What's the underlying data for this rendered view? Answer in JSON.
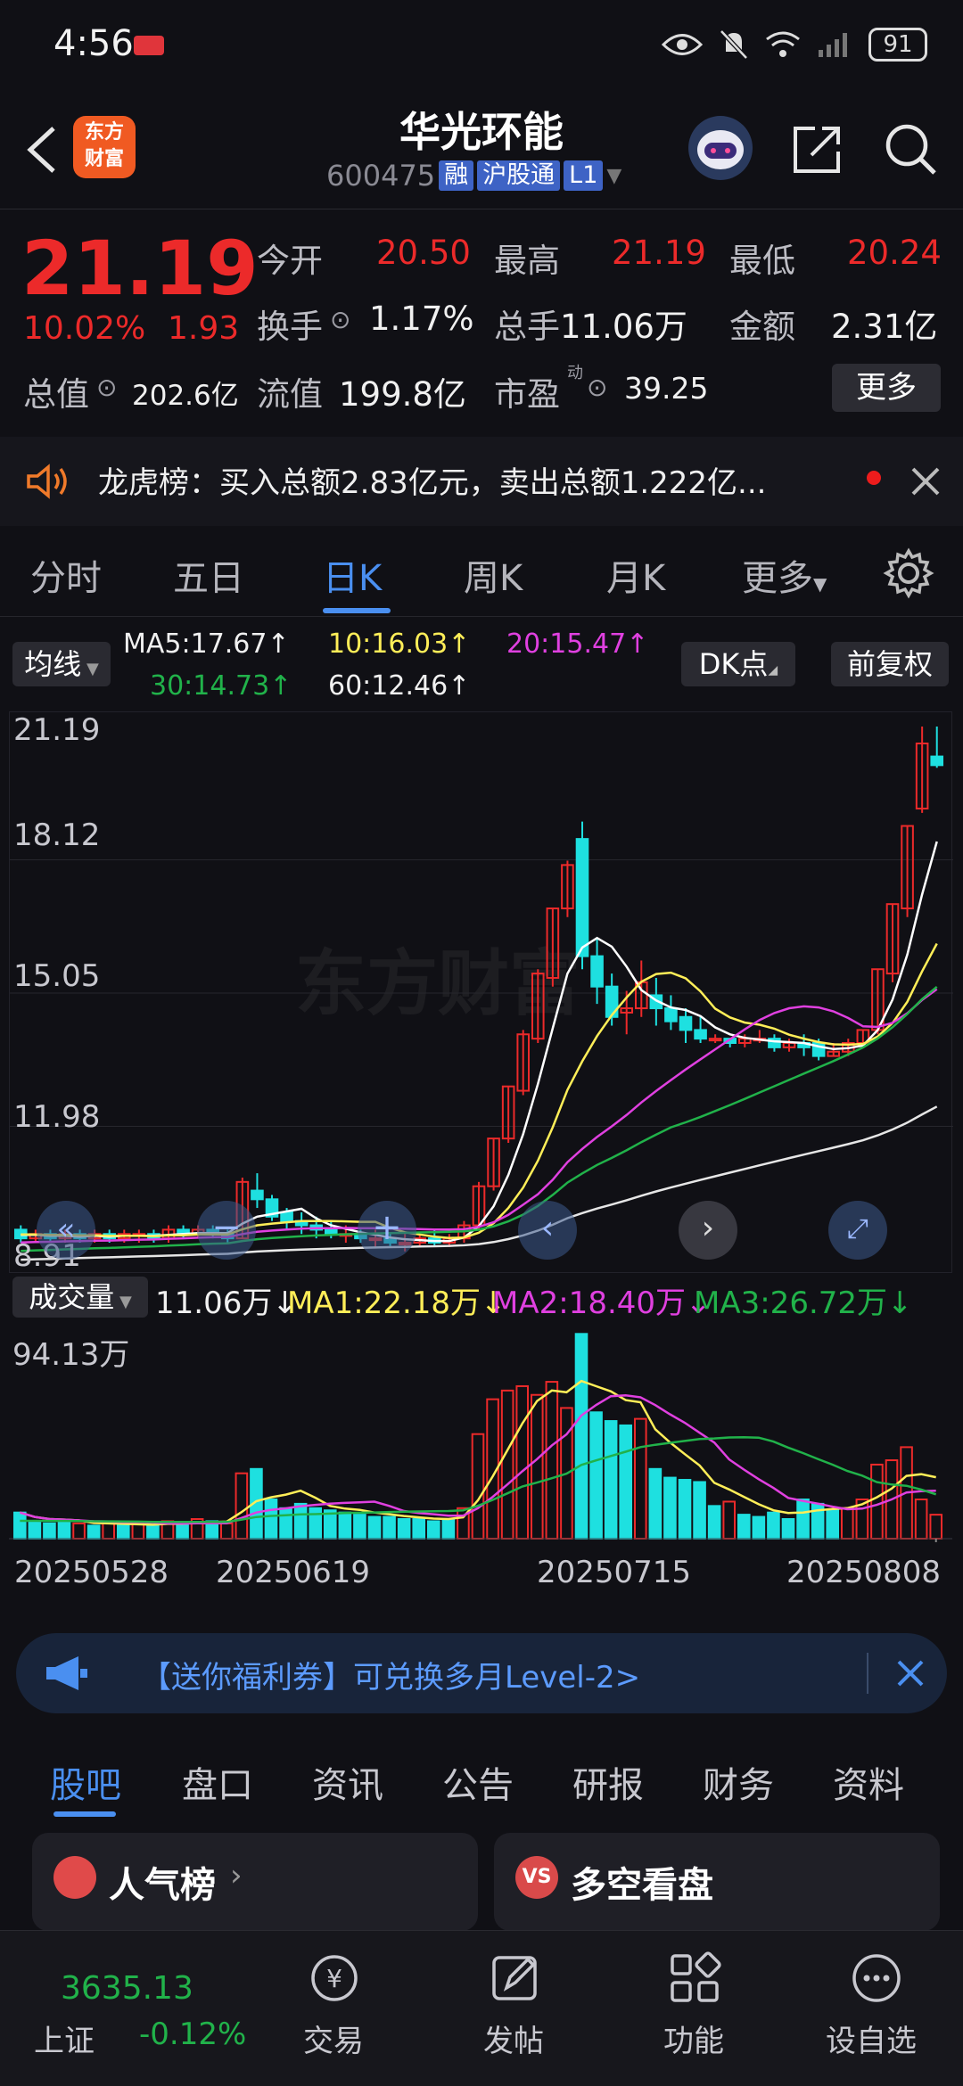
{
  "status_bar": {
    "time": "4:56",
    "battery": "91"
  },
  "header": {
    "stock_name": "华光环能",
    "code": "600475",
    "tags": [
      "融",
      "沪股通",
      "L1"
    ],
    "logo_line1": "东方",
    "logo_line2": "财富"
  },
  "quote": {
    "price": "21.19",
    "change_pct": "10.02%",
    "change_amt": "1.93",
    "fields": {
      "open_label": "今开",
      "open": "20.50",
      "high_label": "最高",
      "high": "21.19",
      "low_label": "最低",
      "low": "20.24",
      "turnover_label": "换手",
      "turnover": "1.17%",
      "volume_label": "总手",
      "volume": "11.06万",
      "amount_label": "金额",
      "amount": "2.31亿",
      "mcap_label": "总值",
      "mcap": "202.6亿",
      "float_label": "流值",
      "float": "199.8亿",
      "pe_label": "市盈",
      "pe_sup": "动",
      "pe": "39.25"
    },
    "more_label": "更多"
  },
  "notice": {
    "text": "龙虎榜：买入总额2.83亿元，卖出总额1.222亿..."
  },
  "period_tabs": [
    "分时",
    "五日",
    "日K",
    "周K",
    "月K",
    "更多"
  ],
  "active_period": "日K",
  "ma_legend": {
    "selector": "均线",
    "ma5": "MA5:17.67↑",
    "ma10": "10:16.03↑",
    "ma20": "20:15.47↑",
    "ma30": "30:14.73↑",
    "ma60": "60:12.46↑",
    "dk_button": "DK点",
    "adjust_button": "前复权"
  },
  "price_axis": [
    "21.19",
    "18.12",
    "15.05",
    "11.98",
    "8.91"
  ],
  "volume_legend": {
    "selector": "成交量",
    "vol": "11.06万↓",
    "ma1": "MA1:22.18万↓",
    "ma2": "MA2:18.40万↓",
    "ma3": "MA3:26.72万↓",
    "max": "94.13万"
  },
  "x_dates": [
    "20250528",
    "20250619",
    "20250715",
    "20250808"
  ],
  "watermark": "东方财富",
  "promo": {
    "text": "【送你福利券】可兑换多月Level-2>"
  },
  "section_tabs": [
    "股吧",
    "盘口",
    "资讯",
    "公告",
    "研报",
    "财务",
    "资料"
  ],
  "cards": [
    {
      "title": "人气榜"
    },
    {
      "title": "多空看盘"
    }
  ],
  "bottom_nav": {
    "index_value": "3635.13",
    "index_name": "上证",
    "index_change": "-0.12%",
    "items": [
      "交易",
      "发帖",
      "功能",
      "设自选"
    ]
  },
  "colors": {
    "up": "#ec2a2a",
    "down": "#1ee0e0",
    "accent": "#4a8ff0",
    "ma5": "#ffffff",
    "ma10": "#ffee58",
    "ma20": "#e040e0",
    "ma30": "#21b24a",
    "ma60": "#e6e6e6"
  },
  "chart_data": {
    "type": "candlestick",
    "y_range": [
      8.91,
      21.19
    ],
    "candles": [
      [
        9.6,
        9.4,
        9.7,
        9.3
      ],
      [
        9.4,
        9.5,
        9.6,
        9.3
      ],
      [
        9.5,
        9.4,
        9.6,
        9.3
      ],
      [
        9.4,
        9.5,
        9.6,
        9.3
      ],
      [
        9.5,
        9.4,
        9.6,
        9.3
      ],
      [
        9.4,
        9.5,
        9.6,
        9.3
      ],
      [
        9.5,
        9.4,
        9.6,
        9.3
      ],
      [
        9.4,
        9.5,
        9.6,
        9.3
      ],
      [
        9.5,
        9.5,
        9.6,
        9.3
      ],
      [
        9.5,
        9.4,
        9.6,
        9.3
      ],
      [
        9.4,
        9.6,
        9.7,
        9.3
      ],
      [
        9.6,
        9.5,
        9.7,
        9.4
      ],
      [
        9.5,
        9.6,
        9.7,
        9.4
      ],
      [
        9.6,
        9.5,
        9.7,
        9.4
      ],
      [
        9.5,
        9.4,
        9.6,
        9.3
      ],
      [
        9.4,
        10.7,
        10.8,
        9.4
      ],
      [
        10.5,
        10.3,
        10.9,
        10.1
      ],
      [
        10.3,
        9.9,
        10.4,
        9.8
      ],
      [
        10.0,
        9.8,
        10.1,
        9.6
      ],
      [
        9.8,
        9.7,
        10.0,
        9.5
      ],
      [
        9.7,
        9.6,
        9.9,
        9.4
      ],
      [
        9.6,
        9.5,
        9.8,
        9.4
      ],
      [
        9.5,
        9.5,
        9.7,
        9.3
      ],
      [
        9.5,
        9.4,
        9.6,
        9.3
      ],
      [
        9.4,
        9.4,
        9.6,
        9.2
      ],
      [
        9.4,
        9.3,
        9.5,
        9.2
      ],
      [
        9.3,
        9.3,
        9.5,
        9.1
      ],
      [
        9.3,
        9.4,
        9.5,
        9.2
      ],
      [
        9.4,
        9.3,
        9.6,
        9.2
      ],
      [
        9.3,
        9.4,
        9.5,
        9.2
      ],
      [
        9.4,
        9.7,
        9.8,
        9.3
      ],
      [
        9.7,
        10.6,
        10.7,
        9.6
      ],
      [
        10.6,
        11.7,
        11.7,
        10.5
      ],
      [
        11.7,
        12.9,
        12.9,
        11.6
      ],
      [
        12.8,
        14.1,
        14.2,
        12.7
      ],
      [
        14.0,
        15.5,
        15.6,
        13.9
      ],
      [
        15.4,
        17.0,
        17.0,
        15.2
      ],
      [
        17.0,
        18.0,
        18.1,
        16.8
      ],
      [
        18.6,
        15.9,
        19.0,
        15.6
      ],
      [
        15.9,
        15.2,
        16.3,
        14.8
      ],
      [
        15.2,
        14.5,
        15.5,
        14.3
      ],
      [
        14.6,
        14.7,
        15.1,
        14.1
      ],
      [
        14.7,
        15.3,
        15.8,
        14.5
      ],
      [
        15.0,
        14.7,
        15.4,
        14.3
      ],
      [
        14.7,
        14.4,
        15.0,
        14.2
      ],
      [
        14.5,
        14.2,
        14.7,
        13.9
      ],
      [
        14.2,
        14.0,
        14.5,
        13.9
      ],
      [
        14.0,
        14.0,
        14.1,
        13.9
      ],
      [
        14.0,
        13.9,
        14.0,
        13.8
      ],
      [
        13.9,
        14.0,
        14.1,
        13.8
      ],
      [
        14.0,
        14.0,
        14.2,
        13.9
      ],
      [
        14.0,
        13.8,
        14.1,
        13.7
      ],
      [
        13.8,
        13.9,
        14.0,
        13.7
      ],
      [
        13.9,
        13.8,
        14.1,
        13.6
      ],
      [
        13.9,
        13.6,
        14.0,
        13.5
      ],
      [
        13.6,
        13.7,
        13.9,
        13.6
      ],
      [
        13.7,
        13.9,
        14.0,
        13.6
      ],
      [
        13.9,
        14.2,
        14.2,
        13.8
      ],
      [
        14.2,
        15.6,
        15.6,
        14.1
      ],
      [
        15.5,
        17.1,
        17.1,
        15.3
      ],
      [
        17.0,
        18.9,
        18.9,
        16.8
      ],
      [
        19.3,
        20.8,
        21.19,
        19.2
      ],
      [
        20.5,
        20.3,
        21.19,
        20.24
      ]
    ],
    "volume": [
      [
        12,
        1
      ],
      [
        8,
        1
      ],
      [
        7,
        1
      ],
      [
        8,
        1
      ],
      [
        7,
        0
      ],
      [
        6,
        1
      ],
      [
        7,
        0
      ],
      [
        6,
        1
      ],
      [
        7,
        0
      ],
      [
        6,
        1
      ],
      [
        8,
        0
      ],
      [
        7,
        1
      ],
      [
        9,
        0
      ],
      [
        8,
        1
      ],
      [
        7,
        0
      ],
      [
        30,
        0
      ],
      [
        32,
        1
      ],
      [
        18,
        1
      ],
      [
        14,
        1
      ],
      [
        16,
        1
      ],
      [
        14,
        1
      ],
      [
        13,
        1
      ],
      [
        12,
        1
      ],
      [
        11,
        1
      ],
      [
        10,
        1
      ],
      [
        10,
        1
      ],
      [
        9,
        1
      ],
      [
        9,
        1
      ],
      [
        8,
        1
      ],
      [
        9,
        1
      ],
      [
        14,
        0
      ],
      [
        48,
        0
      ],
      [
        64,
        0
      ],
      [
        68,
        0
      ],
      [
        70,
        0
      ],
      [
        66,
        0
      ],
      [
        72,
        0
      ],
      [
        60,
        0
      ],
      [
        94,
        1
      ],
      [
        58,
        1
      ],
      [
        54,
        1
      ],
      [
        52,
        1
      ],
      [
        55,
        0
      ],
      [
        32,
        1
      ],
      [
        28,
        1
      ],
      [
        27,
        1
      ],
      [
        26,
        1
      ],
      [
        15,
        1
      ],
      [
        17,
        0
      ],
      [
        11,
        1
      ],
      [
        10,
        1
      ],
      [
        12,
        1
      ],
      [
        9,
        1
      ],
      [
        18,
        1
      ],
      [
        16,
        1
      ],
      [
        13,
        1
      ],
      [
        14,
        0
      ],
      [
        18,
        0
      ],
      [
        34,
        0
      ],
      [
        36,
        0
      ],
      [
        42,
        0
      ],
      [
        18,
        0
      ],
      [
        11,
        0
      ]
    ]
  }
}
